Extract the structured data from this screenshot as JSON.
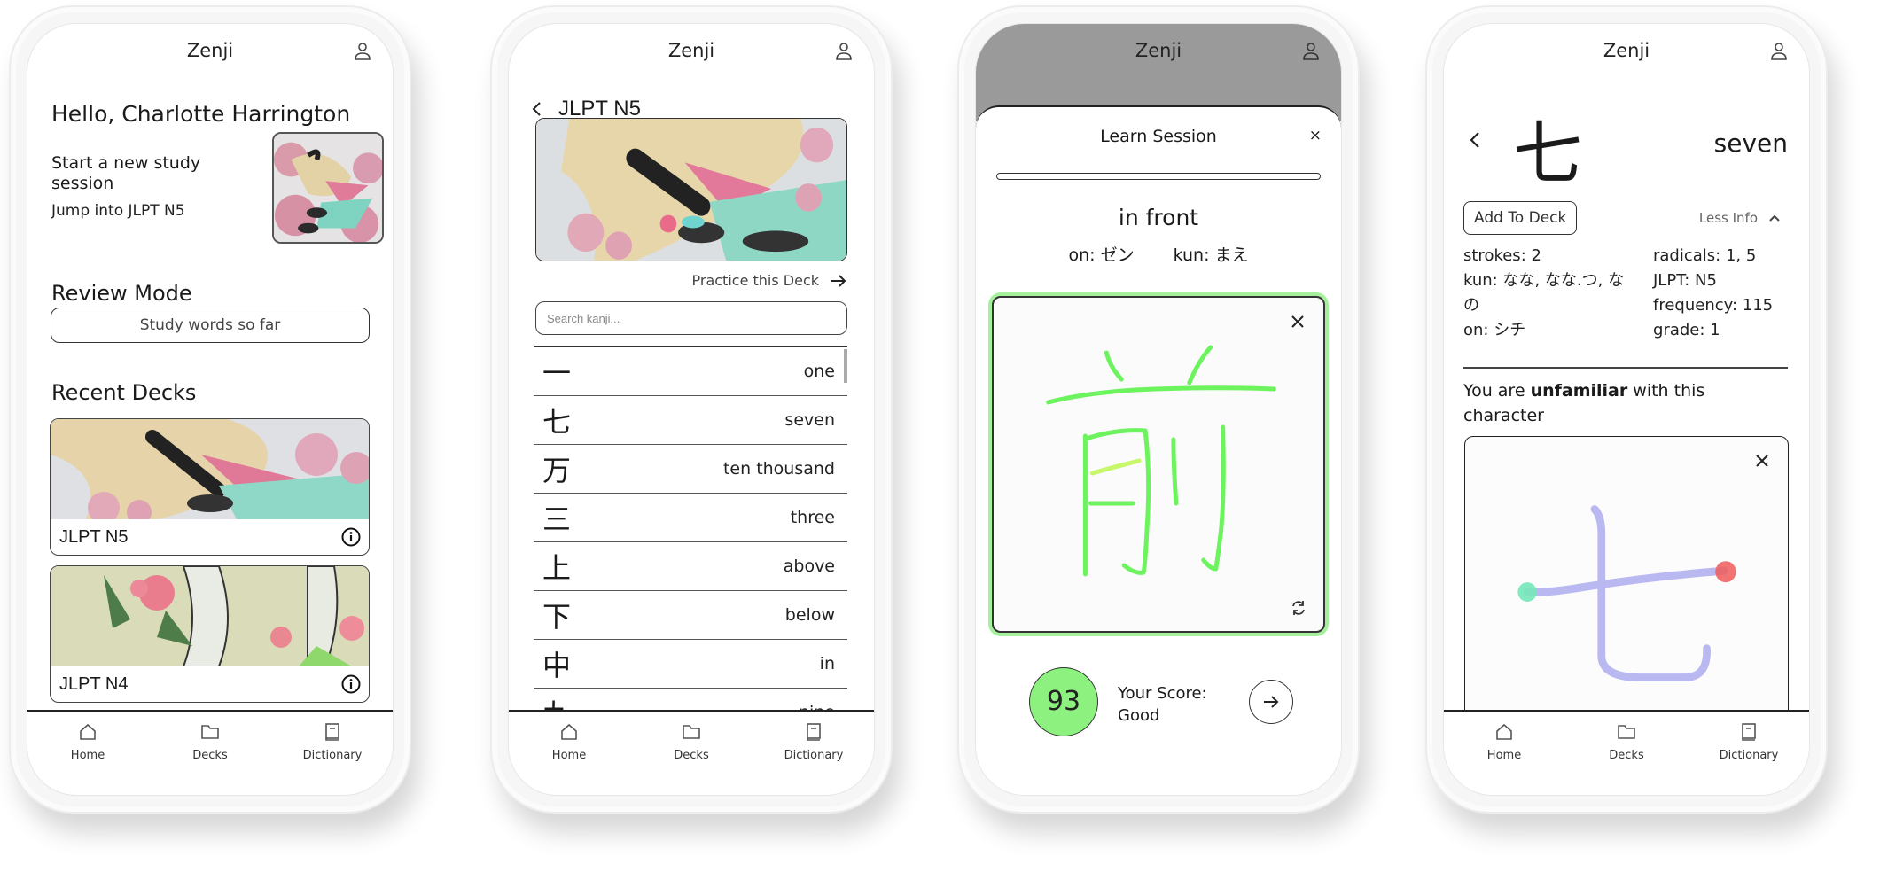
{
  "app": {
    "title": "Zenji"
  },
  "nav": [
    {
      "label": "Home",
      "icon": "home-icon"
    },
    {
      "label": "Decks",
      "icon": "folder-icon"
    },
    {
      "label": "Dictionary",
      "icon": "book-icon"
    }
  ],
  "home": {
    "greeting": "Hello, Charlotte Harrington",
    "study_card": {
      "title": "Start a new study session",
      "subtitle": "Jump into JLPT N5"
    },
    "review_title": "Review Mode",
    "review_button": "Study words so far",
    "recent_title": "Recent Decks",
    "decks": [
      {
        "label": "JLPT N5"
      },
      {
        "label": "JLPT N4"
      }
    ]
  },
  "deck": {
    "title": "JLPT N5",
    "practice_label": "Practice this Deck",
    "search_placeholder": "Search kanji...",
    "kanji": [
      {
        "char": "一",
        "meaning": "one"
      },
      {
        "char": "七",
        "meaning": "seven"
      },
      {
        "char": "万",
        "meaning": "ten thousand"
      },
      {
        "char": "三",
        "meaning": "three"
      },
      {
        "char": "上",
        "meaning": "above"
      },
      {
        "char": "下",
        "meaning": "below"
      },
      {
        "char": "中",
        "meaning": "in"
      },
      {
        "char": "九",
        "meaning": "nine"
      }
    ]
  },
  "session": {
    "title": "Learn Session",
    "close": "×",
    "progress": 0,
    "meaning": "in front",
    "on_reading": "on: ゼン",
    "kun_reading": "kun: まえ",
    "stroke_color": "#6cf35e",
    "score": "93",
    "score_label": "Your Score:",
    "score_rating": "Good",
    "score_color": "#8cf17f"
  },
  "dictionary": {
    "kanji": "七",
    "meaning": "seven",
    "add_button": "Add To Deck",
    "less_info": "Less Info",
    "left_info": [
      "strokes: 2",
      "kun: なな, なな.つ, なの",
      "on: シチ"
    ],
    "right_info": [
      "radicals: 1, 5",
      "JLPT: N5",
      "frequency: 115",
      "grade: 1"
    ],
    "familiarity_prefix": "You are ",
    "familiarity_level": "unfamiliar",
    "familiarity_suffix": " with this character",
    "guide_stroke_color": "#b9b8f1",
    "start_dot_color": "#74e8b8",
    "end_dot_color": "#ef5a5a"
  }
}
